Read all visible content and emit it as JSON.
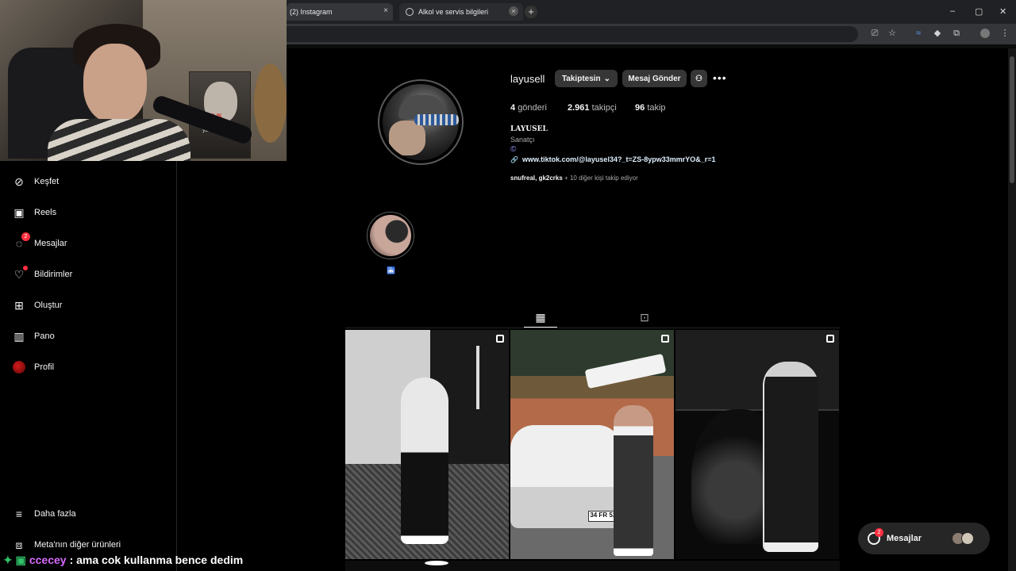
{
  "browser": {
    "tabs": [
      {
        "title": "(2) Instagram",
        "close": "×"
      },
      {
        "title": "Alkol ve servis bilgileri",
        "close": "×"
      }
    ],
    "new_tab": "+",
    "window": {
      "minimize": "–",
      "maximize": "▢",
      "close": "✕"
    }
  },
  "webcam": {
    "poster_stamp": "SATILIK",
    "poster_name": "yavuz çetin"
  },
  "sidebar": {
    "items": [
      {
        "label": "Keşfet",
        "icon": "explore-icon"
      },
      {
        "label": "Reels",
        "icon": "reels-icon"
      },
      {
        "label": "Mesajlar",
        "icon": "messenger-icon",
        "badge": "2"
      },
      {
        "label": "Bildirimler",
        "icon": "heart-icon"
      },
      {
        "label": "Oluştur",
        "icon": "plus-icon"
      },
      {
        "label": "Pano",
        "icon": "dashboard-icon"
      },
      {
        "label": "Profil",
        "icon": "profile-avatar"
      }
    ],
    "more": "Daha fazla",
    "meta": "Meta'nın diğer ürünleri"
  },
  "profile": {
    "username": "layusell",
    "follow_button": "Takiptesin",
    "message_button": "Mesaj Gönder",
    "posts_count": "4",
    "posts_label": "gönderi",
    "followers_count": "2.961",
    "followers_label": "takipçi",
    "following_count": "96",
    "following_label": "takip",
    "full_name": "LAYUSEL",
    "category": "Sanatçı",
    "threads_symbol": "©",
    "link": "www.tiktok.com/@layusel34?_t=ZS-8ypw33mmrYO&_r=1",
    "followed_by_names": "snufreal, gk2crks",
    "followed_by_rest": "+ 10 diğer kişi takip ediyor"
  },
  "highlight": {
    "label": "🛅"
  },
  "posts": [
    {
      "type": "carousel"
    },
    {
      "type": "carousel",
      "plate": "34 FR 530"
    },
    {
      "type": "carousel"
    }
  ],
  "messages_float": {
    "label": "Mesajlar",
    "badge": "2"
  },
  "chat": {
    "badges": "✦ ▣",
    "user": "ccecey",
    "message": ": ama cok kullanma bence dedim"
  },
  "colors": {
    "background": "#000000",
    "badge": "#ff3040",
    "button": "#363636",
    "link": "#e0f1ff",
    "chat_user": "#d96bff"
  }
}
